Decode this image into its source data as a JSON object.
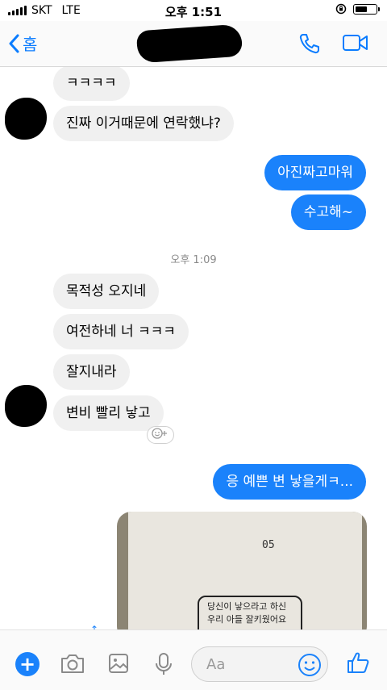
{
  "status": {
    "carrier": "SKT",
    "network": "LTE",
    "time": "오후 1:51"
  },
  "nav": {
    "back_label": "홈"
  },
  "messages": [
    {
      "dir": "in",
      "text": "ㅋㅋㅋㅋ"
    },
    {
      "dir": "in",
      "text": "진짜 이거때문에 연락했냐?"
    },
    {
      "dir": "out",
      "text": "아진짜고마워"
    },
    {
      "dir": "out",
      "text": "수고해~"
    },
    {
      "dir": "in",
      "text": "목적성 오지네"
    },
    {
      "dir": "in",
      "text": "여전하네 너 ㅋㅋㅋ"
    },
    {
      "dir": "in",
      "text": "잘지내라"
    },
    {
      "dir": "in",
      "text": "변비 빨리 낳고"
    },
    {
      "dir": "out",
      "text": "응 예쁜 변 낳을게ㅋ..."
    }
  ],
  "timestamp": "오후 1:09",
  "photo": {
    "page_number": "05",
    "handwriting_line1": "당신이 낳으라고 하신",
    "handwriting_line2": "우리 아들 잘키웠어요"
  },
  "composer": {
    "placeholder": "Aa"
  },
  "colors": {
    "accent": "#0a7cff",
    "outgoing_bubble": "#1a82fb",
    "incoming_bubble": "#f0f0f0"
  }
}
